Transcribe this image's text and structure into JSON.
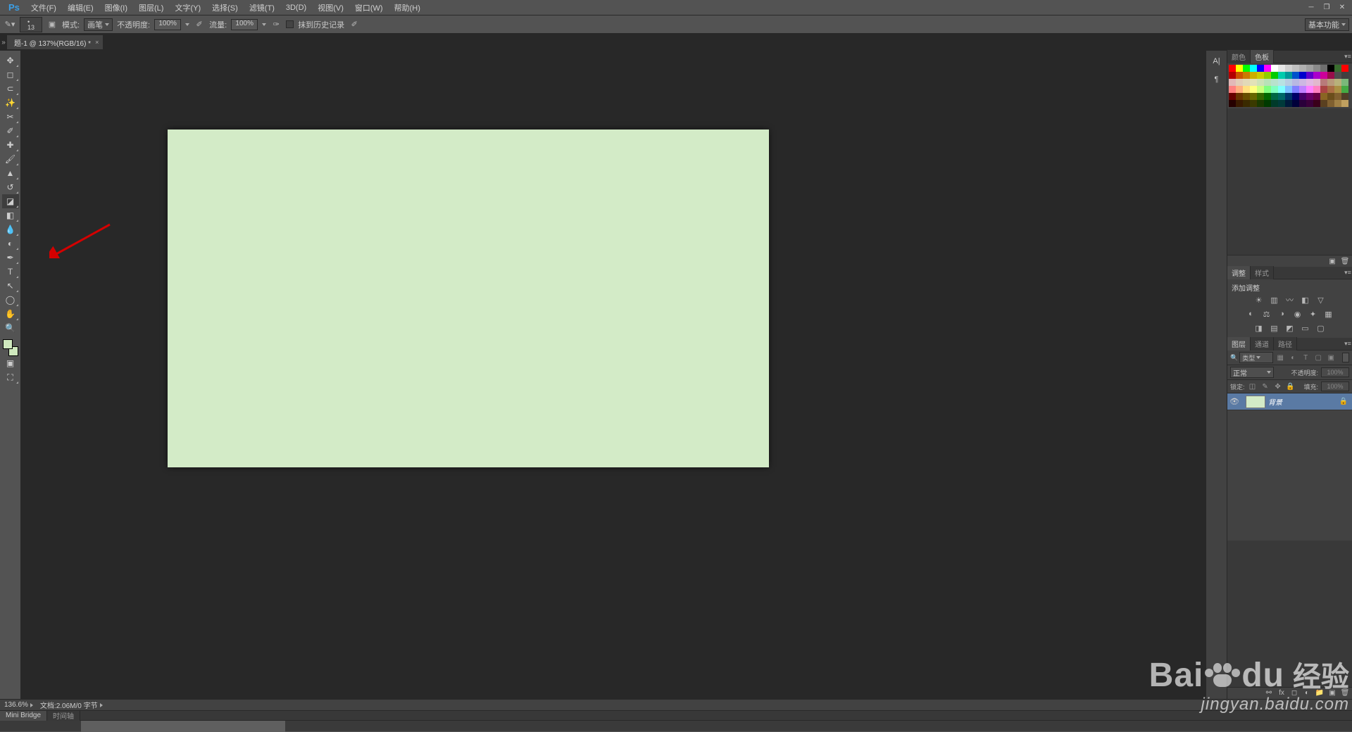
{
  "app_logo": "Ps",
  "menu": [
    "文件(F)",
    "编辑(E)",
    "图像(I)",
    "图层(L)",
    "文字(Y)",
    "选择(S)",
    "滤镜(T)",
    "3D(D)",
    "视图(V)",
    "窗口(W)",
    "帮助(H)"
  ],
  "options": {
    "brush_size": "13",
    "mode_label": "模式:",
    "mode_value": "画笔",
    "opacity_label": "不透明度:",
    "opacity_value": "100%",
    "flow_label": "流量:",
    "flow_value": "100%",
    "history_label": "抹到历史记录"
  },
  "workspace_label": "基本功能",
  "doc_tab": "题-1 @ 137%(RGB/16) *",
  "status": {
    "zoom": "136.6%",
    "doc_info": "文档:2.06M/0 字节"
  },
  "bottom_tabs": [
    "Mini Bridge",
    "时间轴"
  ],
  "right": {
    "color_tabs": [
      "颜色",
      "色板"
    ],
    "adjust_tabs": [
      "调整",
      "样式"
    ],
    "adjust_label": "添加调整",
    "layer_tabs": [
      "图层",
      "通道",
      "路径"
    ],
    "layer_kind": "类型",
    "blend_mode": "正常",
    "blend_opacity_label": "不透明度:",
    "blend_opacity": "100%",
    "lock_label": "锁定:",
    "fill_label": "填充:",
    "fill_value": "100%",
    "layer_name": "背景"
  },
  "swatches": [
    [
      "#ff0000",
      "#ffff00",
      "#00ff00",
      "#00ffff",
      "#0000ff",
      "#ff00ff",
      "#ffffff",
      "#e6e6e6",
      "#d0d0d0",
      "#c0c0c0",
      "#b0b0b0",
      "#a0a0a0",
      "#8a8a8a",
      "#6e6e6e",
      "#000000",
      "#396d2f",
      "#ff0000"
    ],
    [
      "#b30000",
      "#cc5200",
      "#cc7a00",
      "#ccae00",
      "#cccc00",
      "#8fcc00",
      "#00cc00",
      "#00ccad",
      "#009999",
      "#0052cc",
      "#0000cc",
      "#5e00cc",
      "#aa00cc",
      "#cc0099",
      "#990d4a",
      "#4e4e4e",
      "#404040"
    ],
    [
      "#e2b8b8",
      "#e2cdb8",
      "#e2d9b8",
      "#e2e2b8",
      "#cde2b8",
      "#b8e2b8",
      "#b8e2cd",
      "#b8e2e2",
      "#b8cde2",
      "#b8b8e2",
      "#cdb8e2",
      "#e2b8e2",
      "#e2b8cd",
      "#b87a7a",
      "#b8997a",
      "#b8b17a",
      "#7ab87a"
    ],
    [
      "#ff8080",
      "#ffb080",
      "#ffe080",
      "#ffff80",
      "#caff80",
      "#80ff80",
      "#80ffc0",
      "#80ffff",
      "#80c0ff",
      "#8080ff",
      "#c080ff",
      "#ff80ff",
      "#ff80c0",
      "#aa4444",
      "#aa6e44",
      "#aa9044",
      "#44aa44"
    ],
    [
      "#660000",
      "#663300",
      "#664d00",
      "#666600",
      "#336600",
      "#006600",
      "#006644",
      "#006666",
      "#003366",
      "#000066",
      "#440066",
      "#660066",
      "#660044",
      "#8a6523",
      "#6b4e1b",
      "#806030",
      "#503e27"
    ],
    [
      "#260000",
      "#3a1a00",
      "#3a2a00",
      "#3a3a00",
      "#1a3a00",
      "#003a00",
      "#003a2a",
      "#003a3a",
      "#001a3a",
      "#00003a",
      "#2a003a",
      "#3a003a",
      "#3a001a",
      "#5a4020",
      "#806030",
      "#a08045",
      "#c0a060"
    ]
  ],
  "canvas_color": "#d3ebc7",
  "watermark": {
    "brand": "Baidu",
    "cn": "经验",
    "url": "jingyan.baidu.com"
  }
}
